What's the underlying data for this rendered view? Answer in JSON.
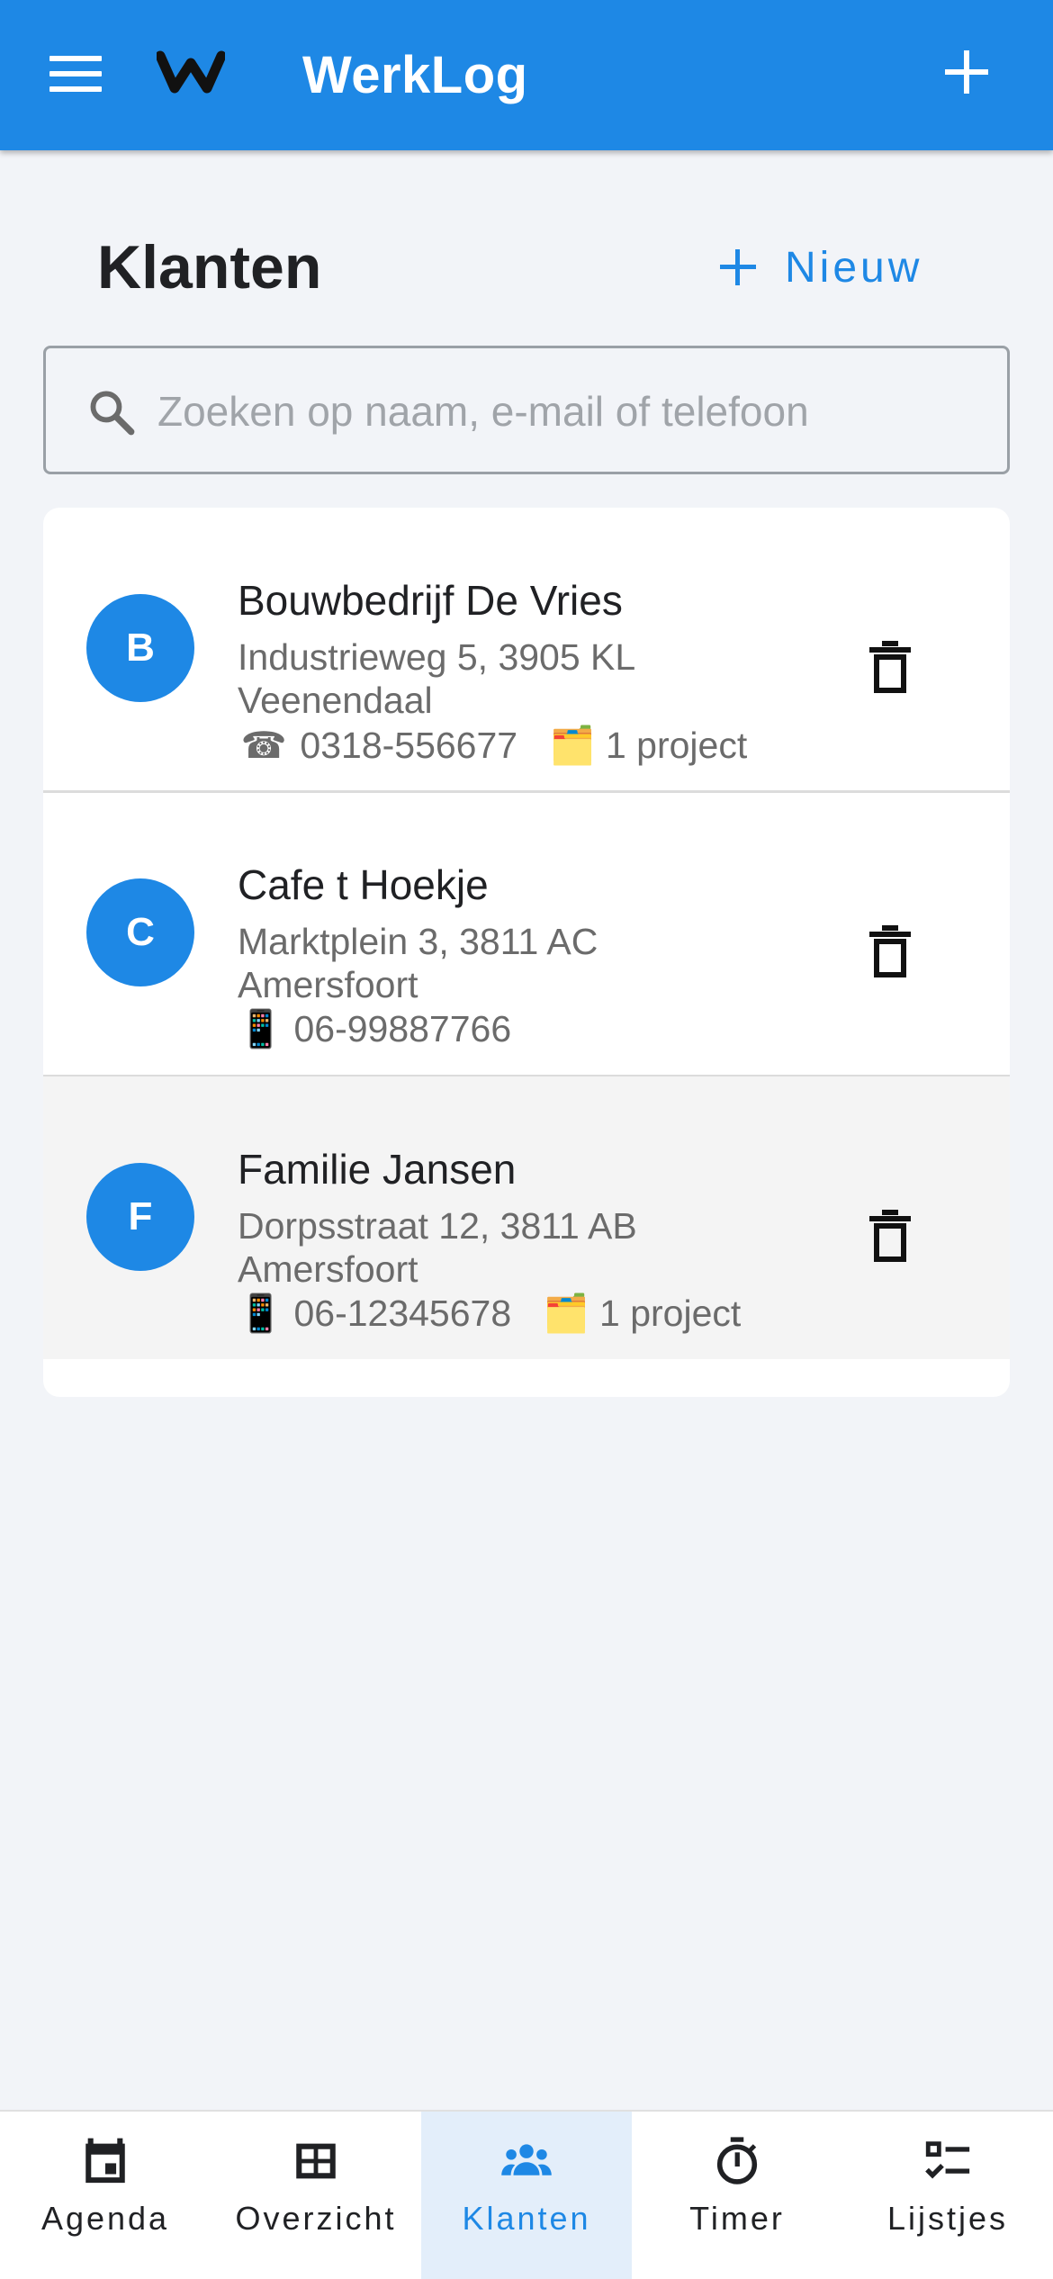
{
  "appbar": {
    "title": "WerkLog",
    "icons": [
      "menu-icon",
      "werklog-logo",
      "plus-icon"
    ],
    "color": "#1e88e5"
  },
  "page": {
    "title": "Klanten",
    "new_button_label": "Nieuw"
  },
  "search": {
    "placeholder": "Zoeken op naam, e-mail of telefoon",
    "value": ""
  },
  "clients": [
    {
      "initial": "B",
      "name": "Bouwbedrijf De Vries",
      "address": "Industrieweg 5, 3905 KL Veenendaal",
      "phone_icon": "☎",
      "phone": "0318-556677",
      "projects_icon": "🗂️",
      "projects": "1 project"
    },
    {
      "initial": "C",
      "name": "Cafe t Hoekje",
      "address": "Marktplein 3, 3811 AC Amersfoort",
      "phone_icon": "📱",
      "phone": "06-99887766",
      "projects_icon": "",
      "projects": ""
    },
    {
      "initial": "F",
      "name": "Familie Jansen",
      "address": "Dorpsstraat 12, 3811 AB Amersfoort",
      "phone_icon": "📱",
      "phone": "06-12345678",
      "projects_icon": "🗂️",
      "projects": "1 project"
    }
  ],
  "bottom_nav": [
    {
      "label": "Agenda",
      "icon": "calendar-icon",
      "active": false
    },
    {
      "label": "Overzicht",
      "icon": "table-icon",
      "active": false
    },
    {
      "label": "Klanten",
      "icon": "people-icon",
      "active": true
    },
    {
      "label": "Timer",
      "icon": "stopwatch-icon",
      "active": false
    },
    {
      "label": "Lijstjes",
      "icon": "checklist-icon",
      "active": false
    }
  ]
}
